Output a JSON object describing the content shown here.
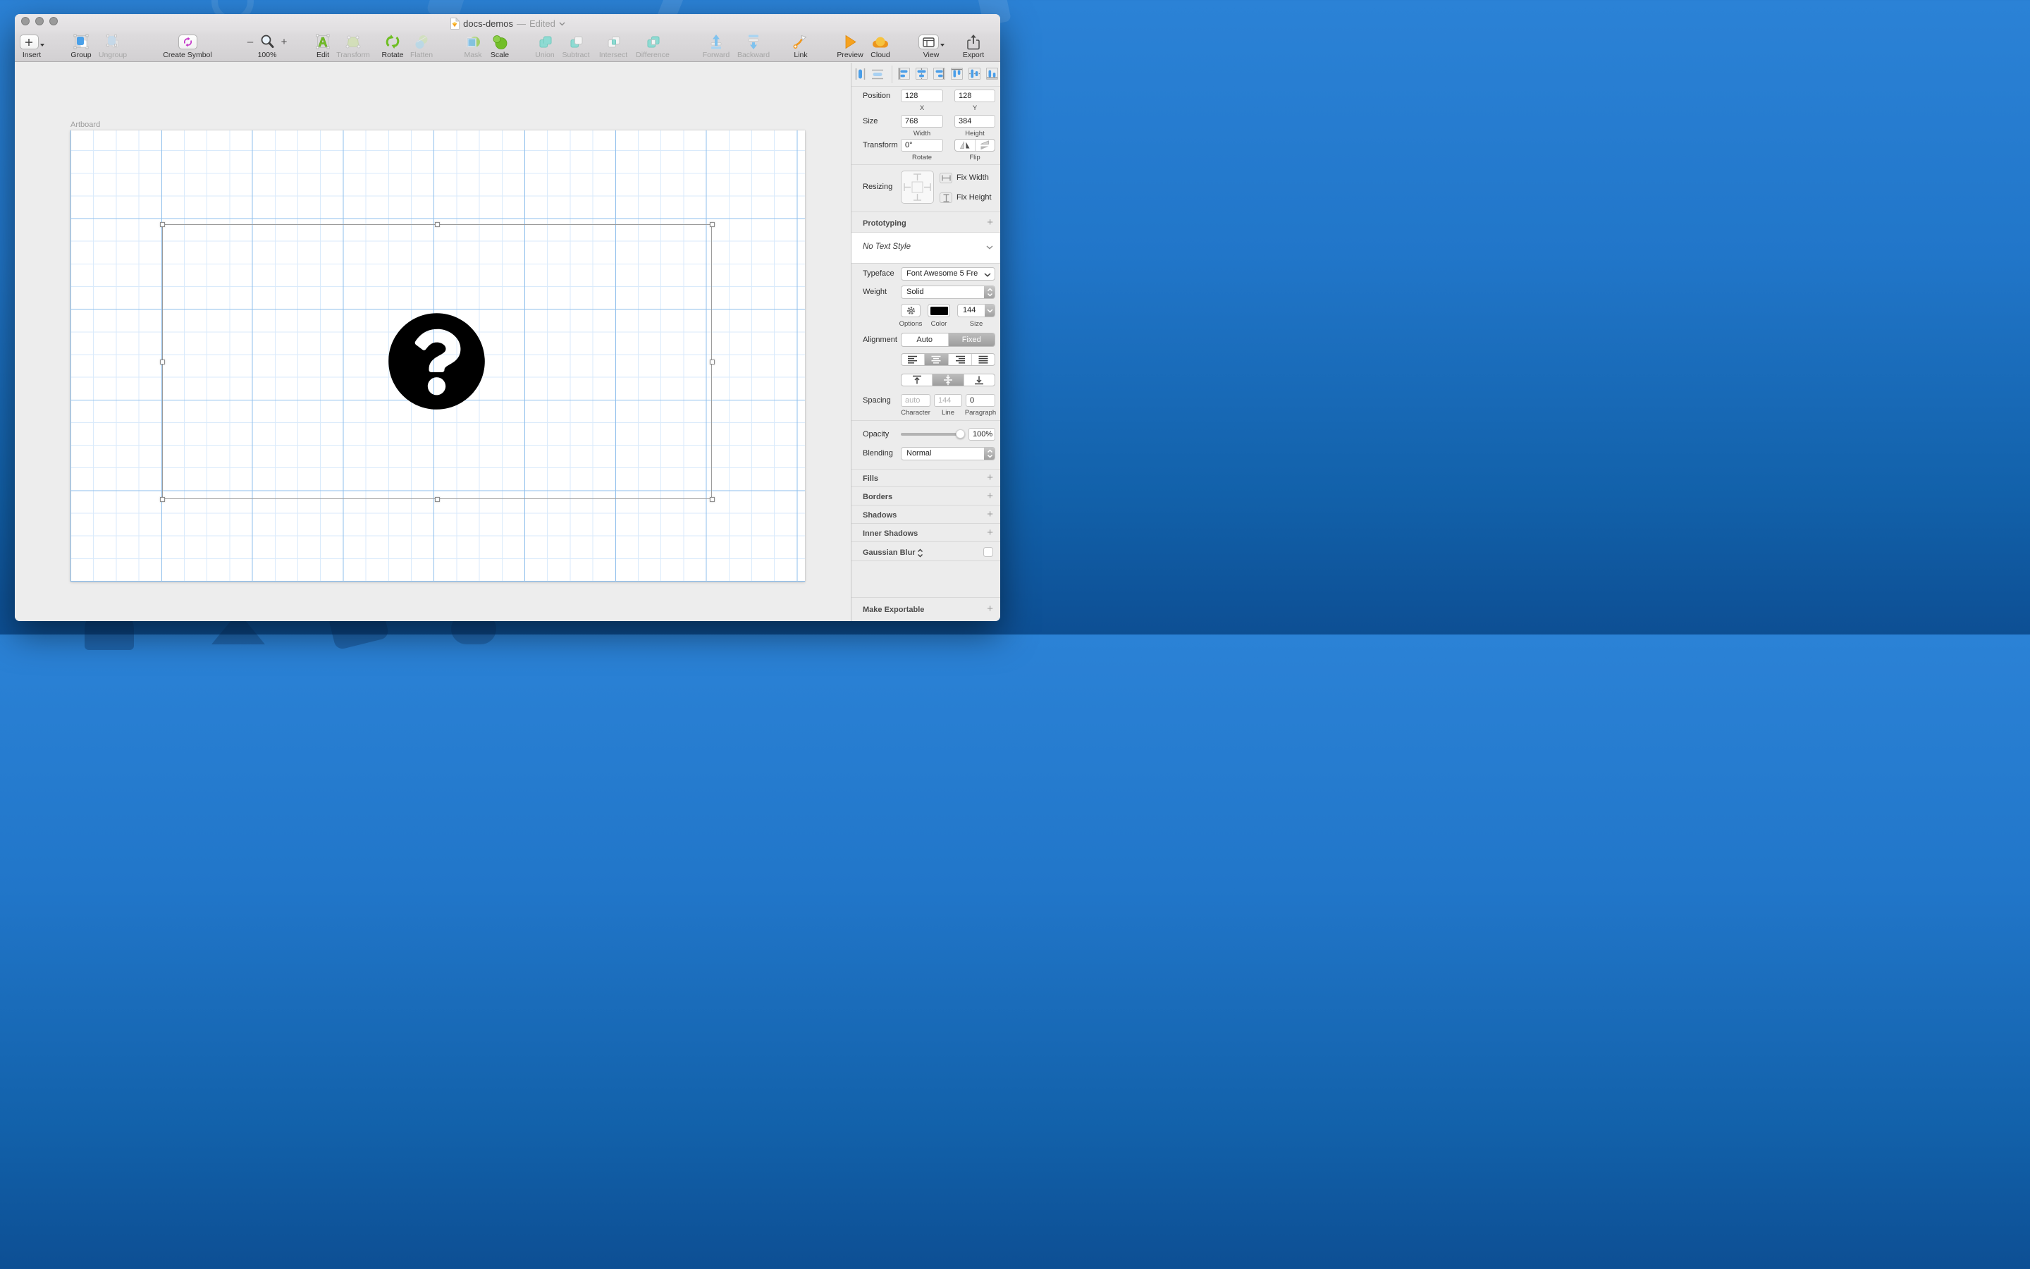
{
  "titlebar": {
    "title": "docs-demos",
    "dash": "—",
    "status": "Edited"
  },
  "toolbar": {
    "insert": "Insert",
    "group": "Group",
    "ungroup": "Ungroup",
    "create_symbol": "Create Symbol",
    "zoom_out": "–",
    "zoom_in": "+",
    "zoom_level": "100%",
    "edit": "Edit",
    "transform": "Transform",
    "rotate": "Rotate",
    "flatten": "Flatten",
    "mask": "Mask",
    "scale": "Scale",
    "union": "Union",
    "subtract": "Subtract",
    "intersect": "Intersect",
    "difference": "Difference",
    "forward": "Forward",
    "backward": "Backward",
    "link": "Link",
    "preview": "Preview",
    "cloud": "Cloud",
    "view": "View",
    "export": "Export"
  },
  "canvas": {
    "artboard_label": "Artboard"
  },
  "inspector": {
    "position": {
      "label": "Position",
      "x": "128",
      "y": "128",
      "x_label": "X",
      "y_label": "Y"
    },
    "size": {
      "label": "Size",
      "width": "768",
      "height": "384",
      "width_label": "Width",
      "height_label": "Height"
    },
    "transform": {
      "label": "Transform",
      "rotate": "0°",
      "rotate_label": "Rotate",
      "flip_label": "Flip"
    },
    "resizing": {
      "label": "Resizing",
      "fix_width": "Fix Width",
      "fix_height": "Fix Height"
    },
    "prototyping": {
      "label": "Prototyping"
    },
    "text_style": {
      "value": "No Text Style"
    },
    "typeface": {
      "label": "Typeface",
      "value": "Font Awesome 5 Fre"
    },
    "weight": {
      "label": "Weight",
      "value": "Solid"
    },
    "glyph": {
      "options_label": "Options",
      "color_label": "Color",
      "size_label": "Size",
      "size_value": "144"
    },
    "alignment": {
      "label": "Alignment",
      "auto_label": "Auto",
      "fixed_label": "Fixed"
    },
    "spacing": {
      "label": "Spacing",
      "character_value": "auto",
      "line_value": "144",
      "paragraph_value": "0",
      "character_label": "Character",
      "line_label": "Line",
      "paragraph_label": "Paragraph"
    },
    "opacity": {
      "label": "Opacity",
      "value": "100%"
    },
    "blending": {
      "label": "Blending",
      "value": "Normal"
    },
    "sections": {
      "fills": "Fills",
      "borders": "Borders",
      "shadows": "Shadows",
      "inner_shadows": "Inner Shadows",
      "gaussian_blur": "Gaussian Blur",
      "make_exportable": "Make Exportable"
    }
  },
  "colors": {
    "accent_blue": "#4A9DE8",
    "green": "#72BE28",
    "teal": "#8EDBD3",
    "orange": "#F5A21F",
    "magenta": "#C437C8",
    "grid_minor": "#D9EAFB",
    "grid_major": "#8FBFEC",
    "glyph_color": "#000000",
    "desktop_blue": "#2176C9"
  }
}
